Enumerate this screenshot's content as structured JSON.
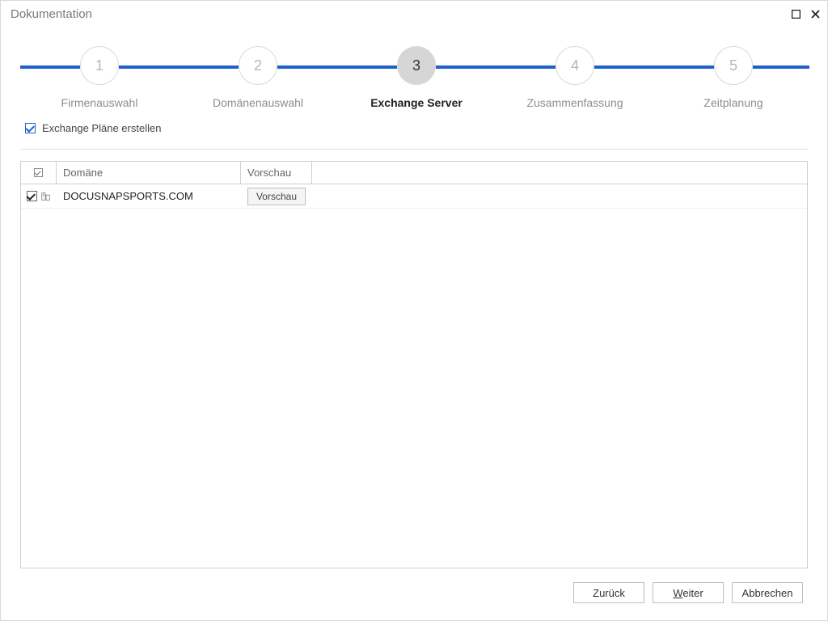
{
  "title": "Dokumentation",
  "steps": [
    {
      "num": "1",
      "label": "Firmenauswahl"
    },
    {
      "num": "2",
      "label": "Domänenauswahl"
    },
    {
      "num": "3",
      "label": "Exchange Server"
    },
    {
      "num": "4",
      "label": "Zusammenfassung"
    },
    {
      "num": "5",
      "label": "Zeitplanung"
    }
  ],
  "active_step": 3,
  "checkbox": {
    "label": "Exchange Pläne erstellen",
    "checked": true
  },
  "grid": {
    "headers": {
      "domain": "Domäne",
      "preview": "Vorschau"
    },
    "rows": [
      {
        "checked": true,
        "domain": "DOCUSNAPSPORTS.COM",
        "preview_btn": "Vorschau"
      }
    ]
  },
  "buttons": {
    "back": "Zurück",
    "next_prefix": "W",
    "next_rest": "eiter",
    "cancel": "Abbrechen"
  }
}
